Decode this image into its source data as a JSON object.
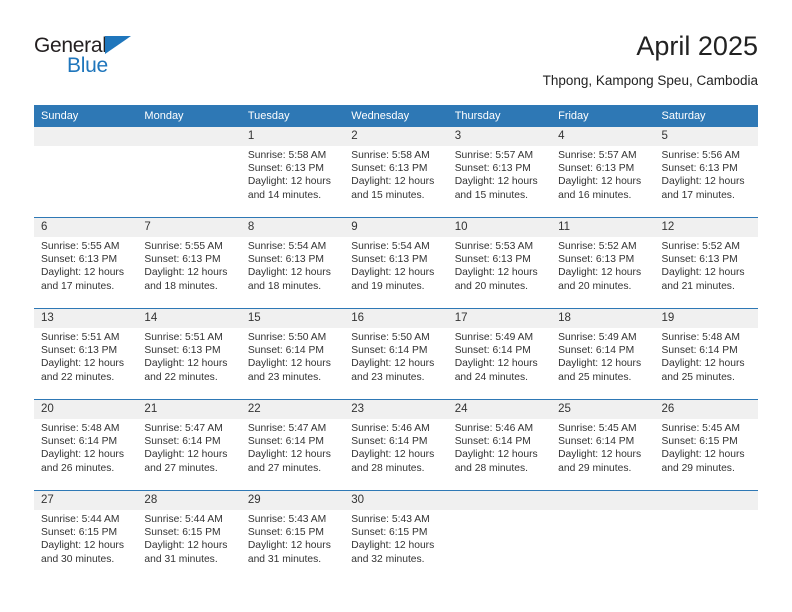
{
  "brand": {
    "name_top": "General",
    "name_bottom": "Blue",
    "triangle_color": "#1f76bc",
    "text_color": "#231f20"
  },
  "header": {
    "title": "April 2025",
    "subtitle": "Thpong, Kampong Speu, Cambodia"
  },
  "theme": {
    "header_blue": "#2e78b5",
    "daynum_band": "#f0f0f0",
    "cell_background": "#ffffff",
    "text": "#333333"
  },
  "calendar": {
    "weekday_headers": [
      "Sunday",
      "Monday",
      "Tuesday",
      "Wednesday",
      "Thursday",
      "Friday",
      "Saturday"
    ],
    "weeks": [
      [
        {
          "day": "",
          "lines": []
        },
        {
          "day": "",
          "lines": []
        },
        {
          "day": "1",
          "lines": [
            "Sunrise: 5:58 AM",
            "Sunset: 6:13 PM",
            "Daylight: 12 hours and 14 minutes."
          ]
        },
        {
          "day": "2",
          "lines": [
            "Sunrise: 5:58 AM",
            "Sunset: 6:13 PM",
            "Daylight: 12 hours and 15 minutes."
          ]
        },
        {
          "day": "3",
          "lines": [
            "Sunrise: 5:57 AM",
            "Sunset: 6:13 PM",
            "Daylight: 12 hours and 15 minutes."
          ]
        },
        {
          "day": "4",
          "lines": [
            "Sunrise: 5:57 AM",
            "Sunset: 6:13 PM",
            "Daylight: 12 hours and 16 minutes."
          ]
        },
        {
          "day": "5",
          "lines": [
            "Sunrise: 5:56 AM",
            "Sunset: 6:13 PM",
            "Daylight: 12 hours and 17 minutes."
          ]
        }
      ],
      [
        {
          "day": "6",
          "lines": [
            "Sunrise: 5:55 AM",
            "Sunset: 6:13 PM",
            "Daylight: 12 hours and 17 minutes."
          ]
        },
        {
          "day": "7",
          "lines": [
            "Sunrise: 5:55 AM",
            "Sunset: 6:13 PM",
            "Daylight: 12 hours and 18 minutes."
          ]
        },
        {
          "day": "8",
          "lines": [
            "Sunrise: 5:54 AM",
            "Sunset: 6:13 PM",
            "Daylight: 12 hours and 18 minutes."
          ]
        },
        {
          "day": "9",
          "lines": [
            "Sunrise: 5:54 AM",
            "Sunset: 6:13 PM",
            "Daylight: 12 hours and 19 minutes."
          ]
        },
        {
          "day": "10",
          "lines": [
            "Sunrise: 5:53 AM",
            "Sunset: 6:13 PM",
            "Daylight: 12 hours and 20 minutes."
          ]
        },
        {
          "day": "11",
          "lines": [
            "Sunrise: 5:52 AM",
            "Sunset: 6:13 PM",
            "Daylight: 12 hours and 20 minutes."
          ]
        },
        {
          "day": "12",
          "lines": [
            "Sunrise: 5:52 AM",
            "Sunset: 6:13 PM",
            "Daylight: 12 hours and 21 minutes."
          ]
        }
      ],
      [
        {
          "day": "13",
          "lines": [
            "Sunrise: 5:51 AM",
            "Sunset: 6:13 PM",
            "Daylight: 12 hours and 22 minutes."
          ]
        },
        {
          "day": "14",
          "lines": [
            "Sunrise: 5:51 AM",
            "Sunset: 6:13 PM",
            "Daylight: 12 hours and 22 minutes."
          ]
        },
        {
          "day": "15",
          "lines": [
            "Sunrise: 5:50 AM",
            "Sunset: 6:14 PM",
            "Daylight: 12 hours and 23 minutes."
          ]
        },
        {
          "day": "16",
          "lines": [
            "Sunrise: 5:50 AM",
            "Sunset: 6:14 PM",
            "Daylight: 12 hours and 23 minutes."
          ]
        },
        {
          "day": "17",
          "lines": [
            "Sunrise: 5:49 AM",
            "Sunset: 6:14 PM",
            "Daylight: 12 hours and 24 minutes."
          ]
        },
        {
          "day": "18",
          "lines": [
            "Sunrise: 5:49 AM",
            "Sunset: 6:14 PM",
            "Daylight: 12 hours and 25 minutes."
          ]
        },
        {
          "day": "19",
          "lines": [
            "Sunrise: 5:48 AM",
            "Sunset: 6:14 PM",
            "Daylight: 12 hours and 25 minutes."
          ]
        }
      ],
      [
        {
          "day": "20",
          "lines": [
            "Sunrise: 5:48 AM",
            "Sunset: 6:14 PM",
            "Daylight: 12 hours and 26 minutes."
          ]
        },
        {
          "day": "21",
          "lines": [
            "Sunrise: 5:47 AM",
            "Sunset: 6:14 PM",
            "Daylight: 12 hours and 27 minutes."
          ]
        },
        {
          "day": "22",
          "lines": [
            "Sunrise: 5:47 AM",
            "Sunset: 6:14 PM",
            "Daylight: 12 hours and 27 minutes."
          ]
        },
        {
          "day": "23",
          "lines": [
            "Sunrise: 5:46 AM",
            "Sunset: 6:14 PM",
            "Daylight: 12 hours and 28 minutes."
          ]
        },
        {
          "day": "24",
          "lines": [
            "Sunrise: 5:46 AM",
            "Sunset: 6:14 PM",
            "Daylight: 12 hours and 28 minutes."
          ]
        },
        {
          "day": "25",
          "lines": [
            "Sunrise: 5:45 AM",
            "Sunset: 6:14 PM",
            "Daylight: 12 hours and 29 minutes."
          ]
        },
        {
          "day": "26",
          "lines": [
            "Sunrise: 5:45 AM",
            "Sunset: 6:15 PM",
            "Daylight: 12 hours and 29 minutes."
          ]
        }
      ],
      [
        {
          "day": "27",
          "lines": [
            "Sunrise: 5:44 AM",
            "Sunset: 6:15 PM",
            "Daylight: 12 hours and 30 minutes."
          ]
        },
        {
          "day": "28",
          "lines": [
            "Sunrise: 5:44 AM",
            "Sunset: 6:15 PM",
            "Daylight: 12 hours and 31 minutes."
          ]
        },
        {
          "day": "29",
          "lines": [
            "Sunrise: 5:43 AM",
            "Sunset: 6:15 PM",
            "Daylight: 12 hours and 31 minutes."
          ]
        },
        {
          "day": "30",
          "lines": [
            "Sunrise: 5:43 AM",
            "Sunset: 6:15 PM",
            "Daylight: 12 hours and 32 minutes."
          ]
        },
        {
          "day": "",
          "lines": []
        },
        {
          "day": "",
          "lines": []
        },
        {
          "day": "",
          "lines": []
        }
      ]
    ]
  }
}
